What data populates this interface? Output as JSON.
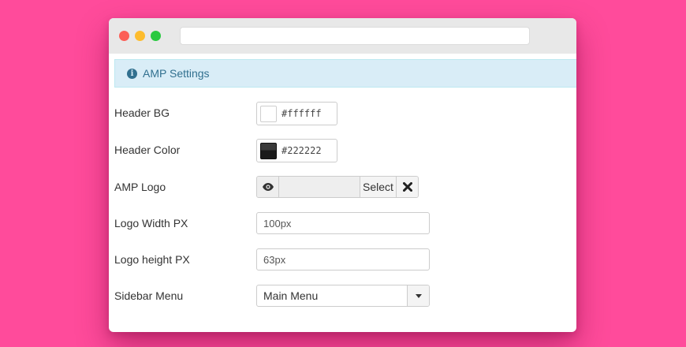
{
  "alert": {
    "icon": "info-icon",
    "text": "AMP Settings"
  },
  "fields": {
    "header_bg": {
      "label": "Header BG",
      "value": "#ffffff",
      "swatch": "#ffffff"
    },
    "header_color": {
      "label": "Header Color",
      "value": "#222222",
      "swatch": "#222222"
    },
    "amp_logo": {
      "label": "AMP Logo",
      "preview_icon": "eye-icon",
      "select_label": "Select",
      "clear_icon": "close-icon"
    },
    "logo_width": {
      "label": "Logo Width PX",
      "value": "100px"
    },
    "logo_height": {
      "label": "Logo height PX",
      "value": "63px"
    },
    "sidebar_menu": {
      "label": "Sidebar Menu",
      "value": "Main Menu",
      "caret_icon": "caret-down-icon"
    }
  },
  "colors": {
    "page_background": "#ff4b9b",
    "alert_background": "#d9edf7",
    "alert_text": "#31708f"
  }
}
